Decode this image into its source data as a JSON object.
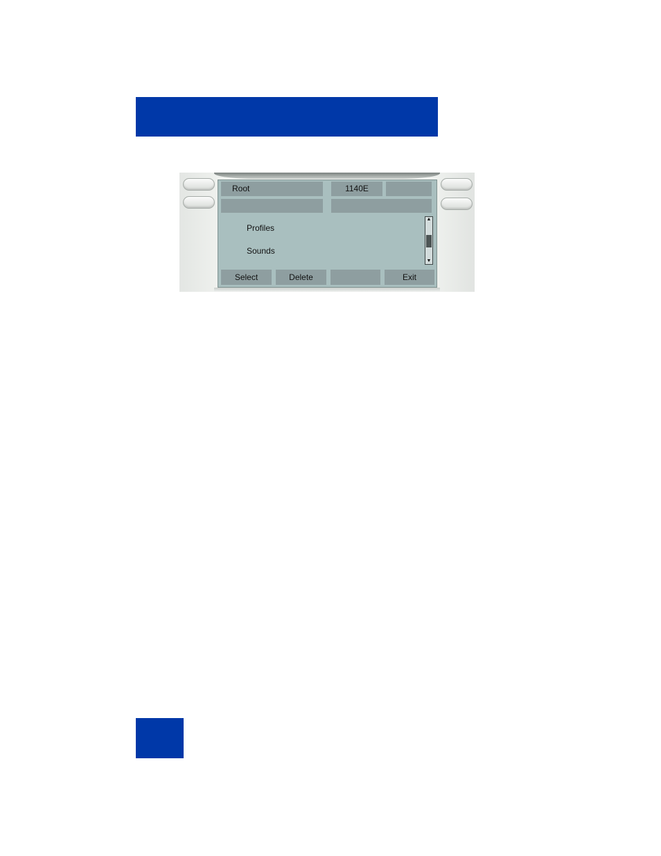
{
  "header": {
    "color": "#0038a8"
  },
  "page_tab": {
    "color": "#0038a8"
  },
  "phone": {
    "title_left": "Root",
    "model": "1140E",
    "menu": [
      "Profiles",
      "Sounds"
    ],
    "softkeys": [
      "Select",
      "Delete",
      "",
      "Exit"
    ],
    "screen_color": "#a9bfbf",
    "icons": [
      "scroll-up-arrow",
      "scroll-down-arrow"
    ]
  }
}
